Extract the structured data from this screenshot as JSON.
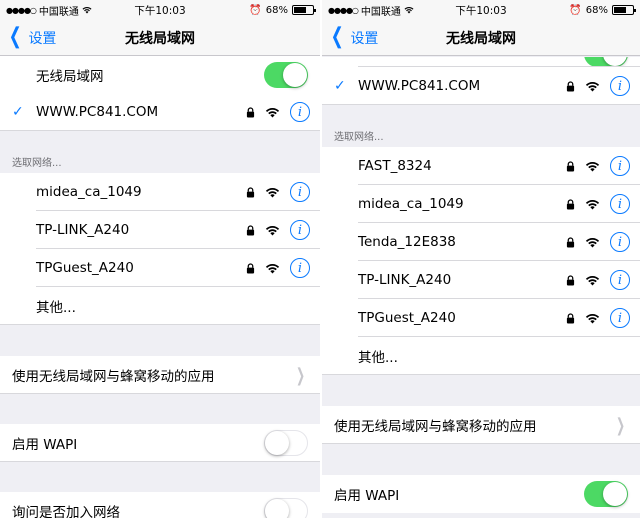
{
  "status": {
    "carrier": "中国联通",
    "time": "下午10:03",
    "battery_text": "68%",
    "battery_level": 0.68
  },
  "nav": {
    "back_label": "设置",
    "title": "无线局域网"
  },
  "left": {
    "wlan_label": "无线局域网",
    "connected_network": "WWW.PC841.COM",
    "choose_header": "选取网络...",
    "networks": [
      "midea_ca_1049",
      "TP-LINK_A240",
      "TPGuest_A240"
    ],
    "other_label": "其他...",
    "apps_label": "使用无线局域网与蜂窝移动的应用",
    "wapi_label": "启用 WAPI",
    "ask_label": "询问是否加入网络"
  },
  "right": {
    "connected_network": "WWW.PC841.COM",
    "choose_header": "选取网络...",
    "networks": [
      "FAST_8324",
      "midea_ca_1049",
      "Tenda_12E838",
      "TP-LINK_A240",
      "TPGuest_A240"
    ],
    "other_label": "其他...",
    "apps_label": "使用无线局域网与蜂窝移动的应用",
    "wapi_label": "启用 WAPI"
  },
  "colors": {
    "accent": "#0a7aff",
    "toggle_on": "#4cd964",
    "background": "#efeff4"
  },
  "toggles": {
    "left_wlan": true,
    "left_wapi": false,
    "left_ask": false,
    "right_wapi": true
  }
}
